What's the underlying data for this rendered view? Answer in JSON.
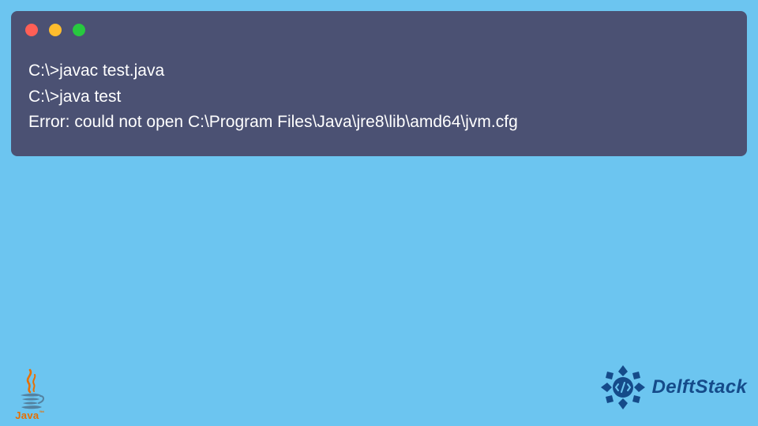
{
  "window": {
    "controls": {
      "close": "red",
      "minimize": "yellow",
      "zoom": "green"
    }
  },
  "terminal": {
    "lines": [
      "C:\\>javac test.java",
      "C:\\>java test",
      "Error: could not open C:\\Program Files\\Java\\jre8\\lib\\amd64\\jvm.cfg"
    ]
  },
  "footer": {
    "java_label": "Java",
    "java_tm": "™",
    "brand": "DelftStack"
  },
  "colors": {
    "page_bg": "#6cc5f0",
    "terminal_bg": "#4b5173",
    "brand_blue": "#154b8a",
    "java_orange": "#e76f00"
  }
}
